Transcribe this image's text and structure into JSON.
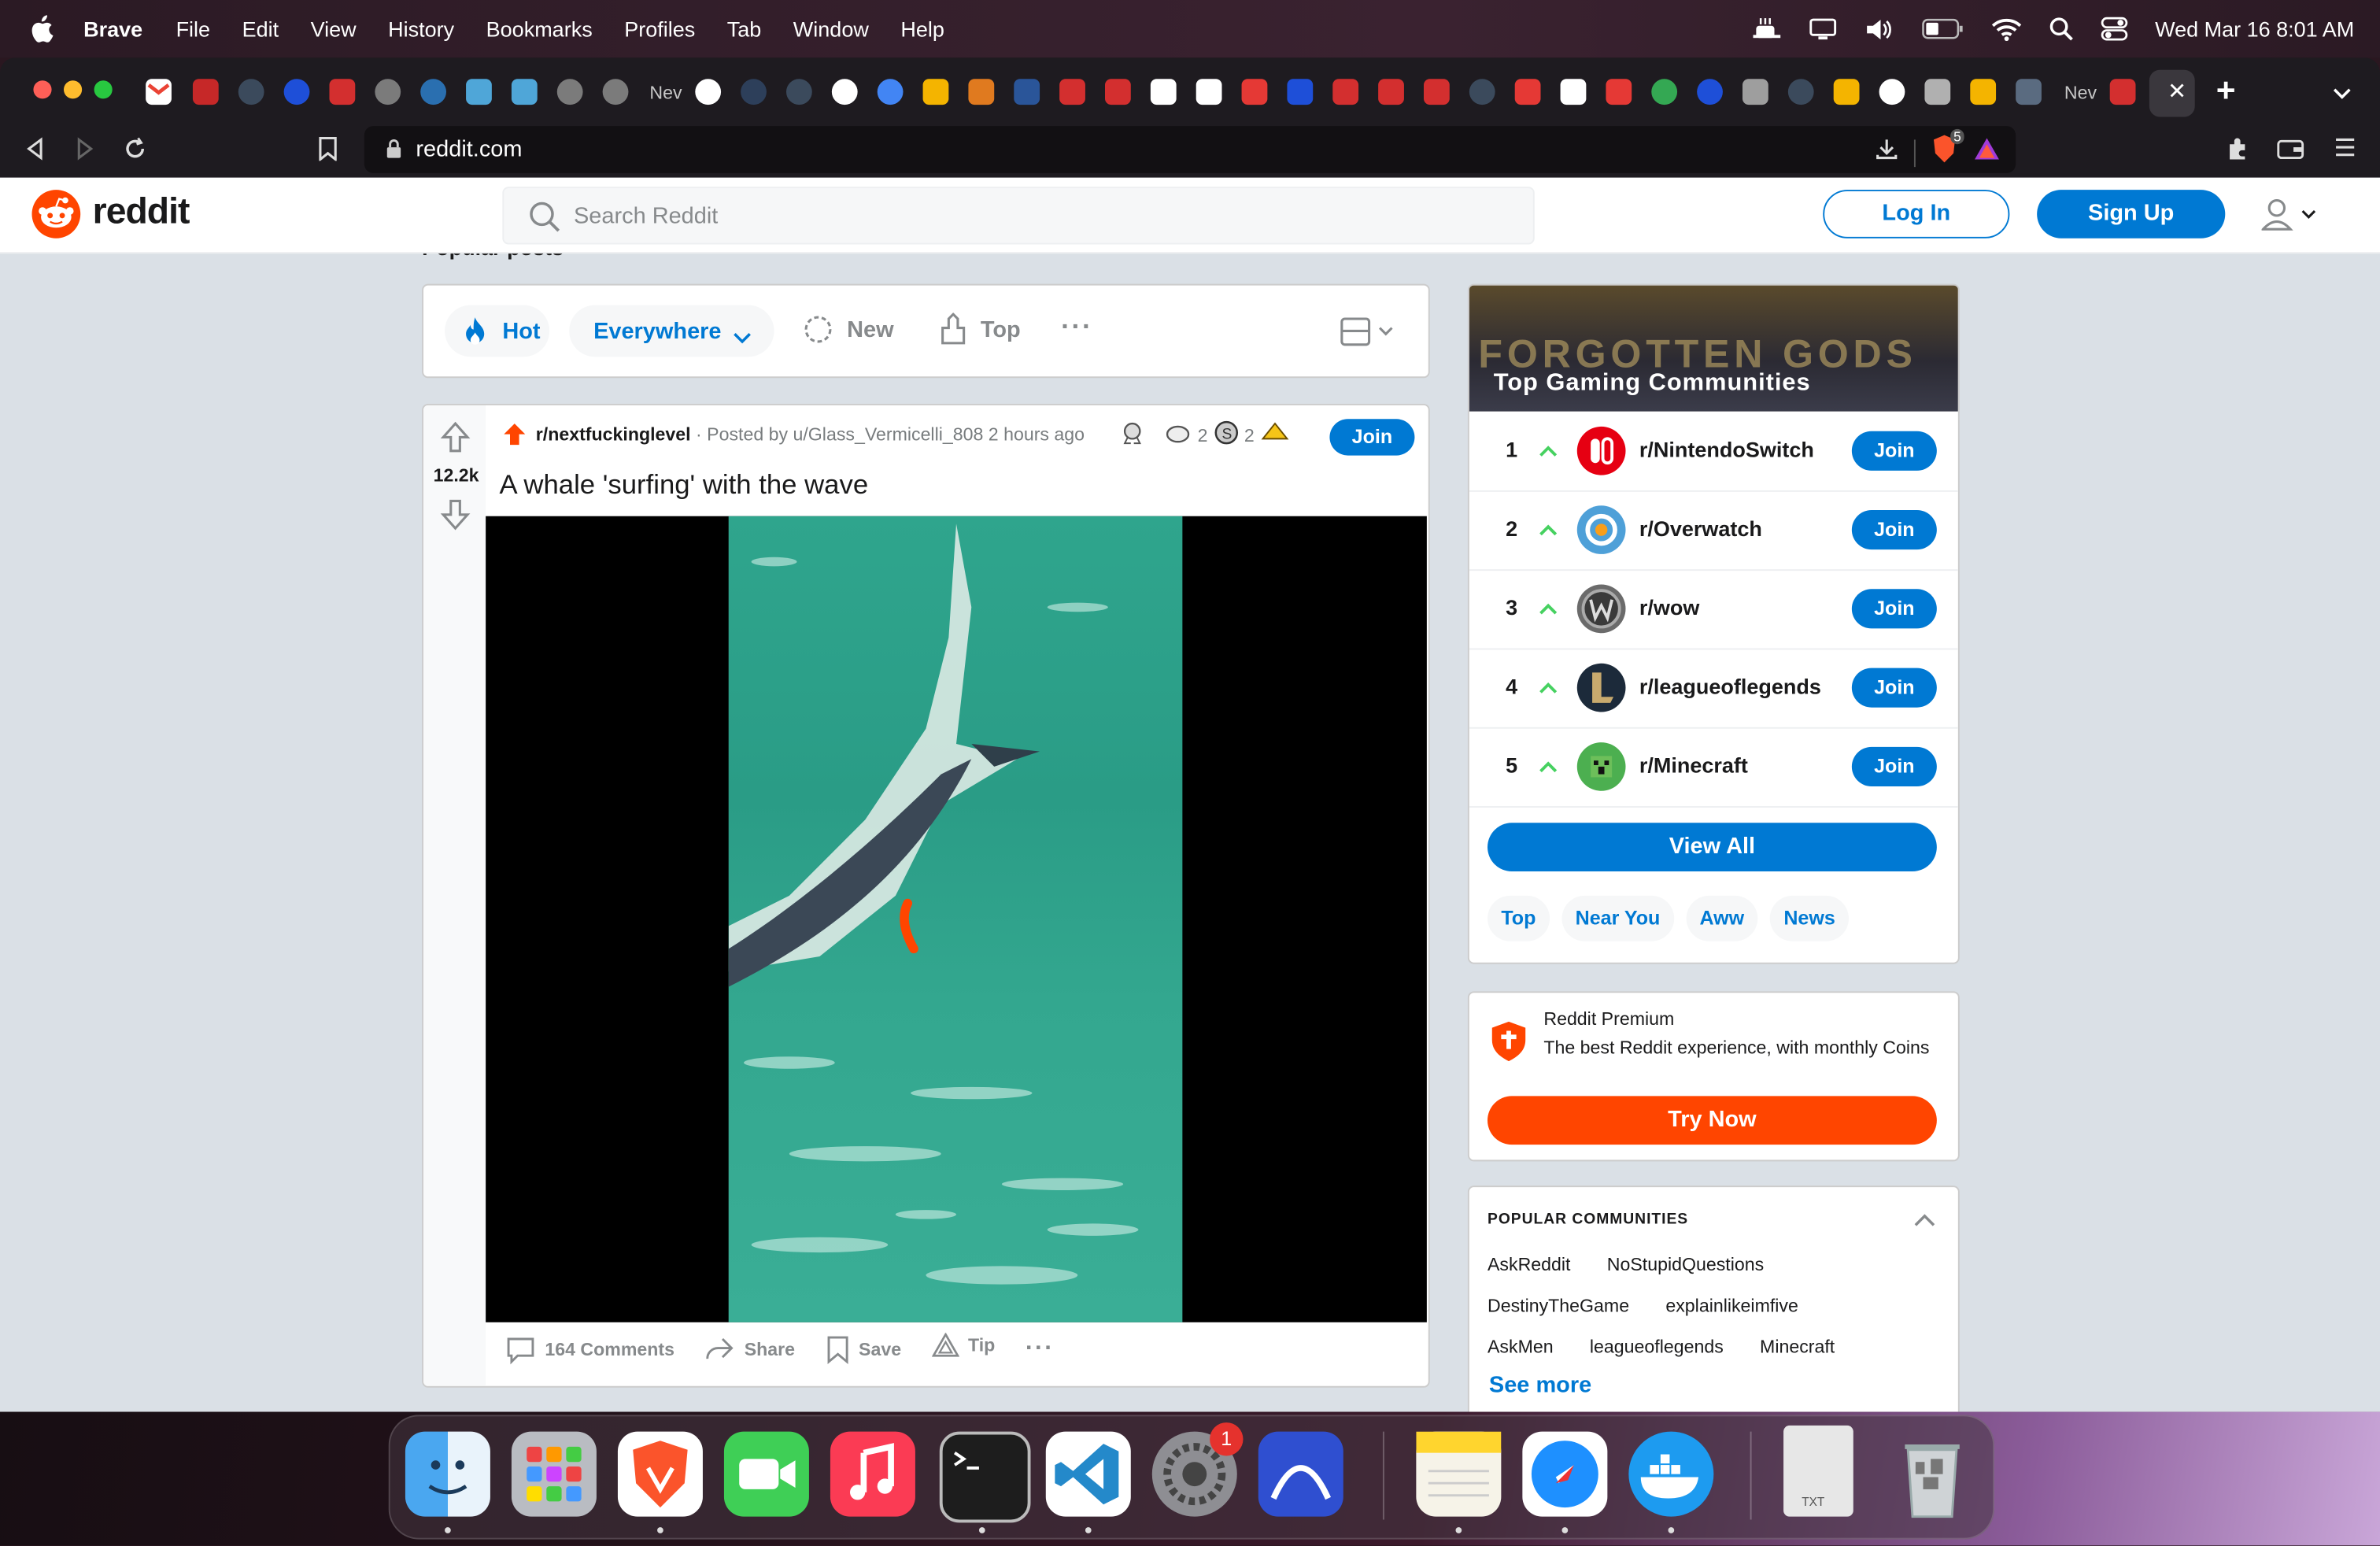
{
  "menubar": {
    "app_name": "Brave",
    "menus": [
      "File",
      "Edit",
      "View",
      "History",
      "Bookmarks",
      "Profiles",
      "Tab",
      "Window",
      "Help"
    ],
    "datetime": "Wed Mar 16  8:01 AM"
  },
  "browser": {
    "tab_labels": {
      "new_a": "Nev",
      "new_b": "Nev"
    },
    "url": "reddit.com",
    "shields_count": "5",
    "accent": "#fb542b"
  },
  "reddit": {
    "logo_text": "reddit",
    "search_placeholder": "Search Reddit",
    "login_label": "Log In",
    "signup_label": "Sign Up",
    "brand_color": "#ff4500",
    "blue": "#0079d3"
  },
  "feed": {
    "section_title": "Popular posts",
    "sort": {
      "hot": "Hot",
      "location": "Everywhere",
      "new": "New",
      "top": "Top",
      "more": "···"
    }
  },
  "post": {
    "vote_count": "12.2k",
    "subreddit": "r/nextfuckinglevel",
    "posted_by": " · Posted by u/Glass_Vermicelli_808 2 hours ago",
    "award_count_a": "2",
    "award_count_b": "2",
    "join_label": "Join",
    "title": "A whale 'surfing' with the wave",
    "actions": {
      "comments": "164 Comments",
      "share": "Share",
      "save": "Save",
      "tip": "Tip",
      "more": "···"
    }
  },
  "sidebar": {
    "top_gaming": {
      "banner_art": "FORGOTTEN GODS",
      "title": "Top  Gaming  Communities",
      "communities": [
        {
          "rank": "1",
          "name": "r/NintendoSwitch",
          "join": "Join"
        },
        {
          "rank": "2",
          "name": "r/Overwatch",
          "join": "Join"
        },
        {
          "rank": "3",
          "name": "r/wow",
          "join": "Join"
        },
        {
          "rank": "4",
          "name": "r/leagueoflegends",
          "join": "Join"
        },
        {
          "rank": "5",
          "name": "r/Minecraft",
          "join": "Join"
        }
      ],
      "view_all": "View All",
      "chips": [
        "Top",
        "Near You",
        "Aww",
        "News"
      ]
    },
    "premium": {
      "title": "Reddit Premium",
      "description": "The best Reddit experience, with monthly Coins",
      "button": "Try Now"
    },
    "popular": {
      "title": "POPULAR COMMUNITIES",
      "rows": [
        [
          "AskReddit",
          "NoStupidQuestions"
        ],
        [
          "DestinyTheGame",
          "explainlikeimfive"
        ],
        [
          "AskMen",
          "leagueoflegends",
          "Minecraft"
        ]
      ],
      "see_more": "See more"
    }
  },
  "dock": {
    "settings_badge": "1",
    "txt_label": "TXT"
  }
}
